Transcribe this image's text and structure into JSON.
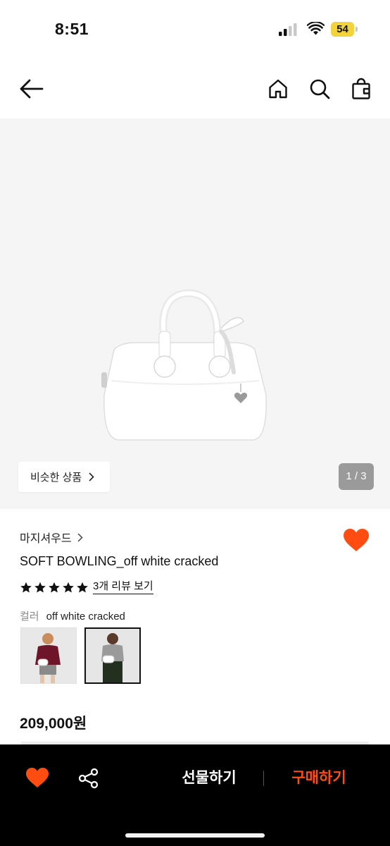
{
  "status_bar": {
    "time": "8:51",
    "battery": "54"
  },
  "nav": {
    "back_icon": "arrow-left-icon",
    "home_icon": "home-icon",
    "search_icon": "search-icon",
    "cart_icon": "shopping-bag-icon"
  },
  "gallery": {
    "similar_label": "비슷한 상품",
    "counter": "1 / 3"
  },
  "product": {
    "brand": "마지셔우드",
    "name": "SOFT BOWLING_off white cracked",
    "rating": 5,
    "review_label": "3개 리뷰 보기",
    "color_label": "컬러",
    "color_value": "off white cracked",
    "price": "209,000원",
    "liked": true
  },
  "bottom_bar": {
    "gift_label": "선물하기",
    "buy_label": "구매하기"
  },
  "colors": {
    "accent": "#ff4d12",
    "bottom_bar_bg": "#000000",
    "battery": "#f3d33b"
  }
}
